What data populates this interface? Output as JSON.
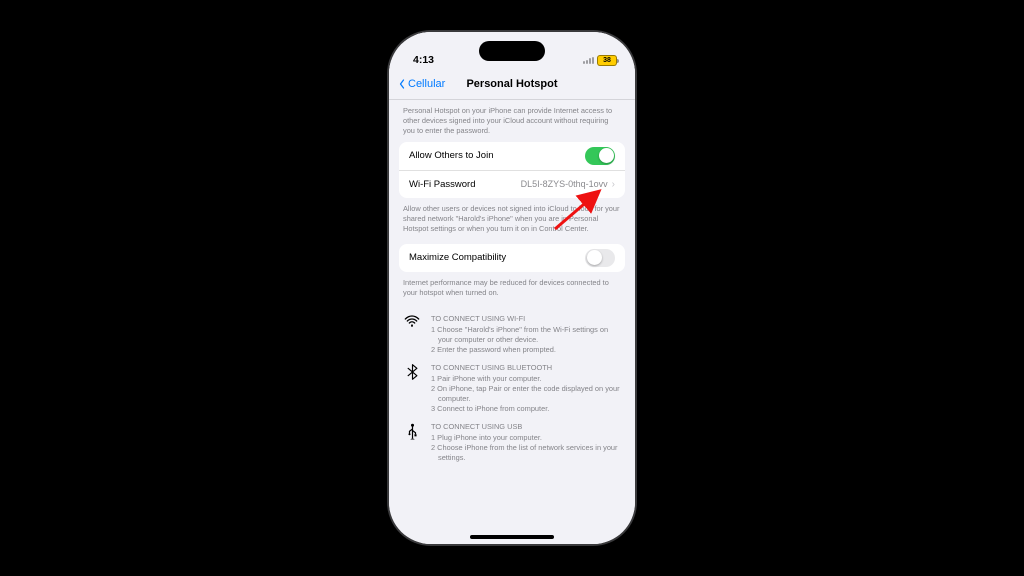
{
  "status": {
    "time": "4:13",
    "battery": "38"
  },
  "nav": {
    "back": "Cellular",
    "title": "Personal Hotspot"
  },
  "hints": {
    "top": "Personal Hotspot on your iPhone can provide Internet access to other devices signed into your iCloud account without requiring you to enter the password.",
    "allow": "Allow other users or devices not signed into iCloud to look for your shared network \"Harold's iPhone\" when you are in Personal Hotspot settings or when you turn it on in Control Center.",
    "compat": "Internet performance may be reduced for devices connected to your hotspot when turned on."
  },
  "rows": {
    "allow_label": "Allow Others to Join",
    "wifi_label": "Wi-Fi Password",
    "wifi_value": "DL5I-8ZYS-0thq-1ovv",
    "compat_label": "Maximize Compatibility"
  },
  "instructions": {
    "wifi_head": "TO CONNECT USING WI-FI",
    "wifi_1": "1 Choose \"Harold's iPhone\" from the Wi-Fi settings on your computer or other device.",
    "wifi_2": "2 Enter the password when prompted.",
    "bt_head": "TO CONNECT USING BLUETOOTH",
    "bt_1": "1 Pair iPhone with your computer.",
    "bt_2": "2 On iPhone, tap Pair or enter the code displayed on your computer.",
    "bt_3": "3 Connect to iPhone from computer.",
    "usb_head": "TO CONNECT USING USB",
    "usb_1": "1 Plug iPhone into your computer.",
    "usb_2": "2 Choose iPhone from the list of network services in your settings."
  }
}
